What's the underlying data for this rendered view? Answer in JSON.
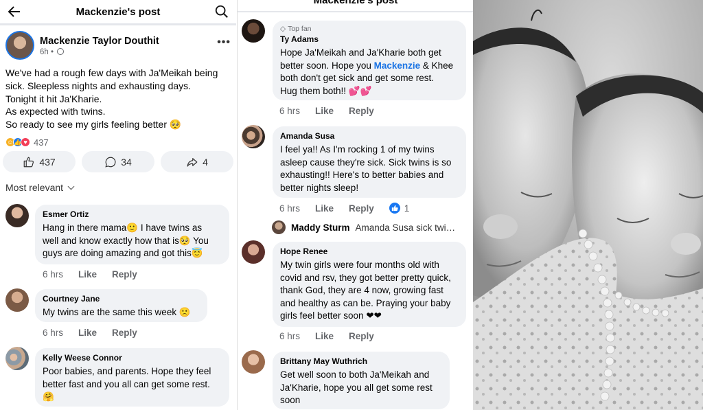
{
  "post": {
    "header_title": "Mackenzie's post",
    "author": "Mackenzie Taylor Douthit",
    "time": "6h",
    "dot": "•",
    "text_lines": [
      "We've had a rough few days with Ja'Meikah being",
      "sick. Sleepless nights and exhausting days.",
      "Tonight it hit Ja'Kharie.",
      "As expected with twins.",
      "So ready to see my girls feeling better 🥺"
    ],
    "reaction_count": "437",
    "like_pill": "437",
    "comment_pill": "34",
    "share_pill": "4",
    "sort_label": "Most relevant"
  },
  "left_comments": [
    {
      "name": "Esmer Ortiz",
      "lines": [
        "Hang in there mama🙂 I have twins as",
        "well and know exactly how that is🥺 You",
        "guys are doing amazing and got this😇"
      ],
      "time": "6 hrs",
      "like": "Like",
      "reply": "Reply"
    },
    {
      "name": "Courtney Jane",
      "lines": [
        "My twins are the same this week 🙁"
      ],
      "time": "6 hrs",
      "like": "Like",
      "reply": "Reply"
    },
    {
      "name": "Kelly Weese Connor",
      "lines": [
        "Poor babies, and parents. Hope they feel",
        "better fast and you all can get some rest.",
        "🤗"
      ]
    }
  ],
  "middle": {
    "header_title": "Mackenzie's post",
    "comments": [
      {
        "badge": "Top fan",
        "name": "Ty Adams",
        "line1": "Hope Ja'Meikah and Ja'Kharie both get",
        "line2_pre": "better soon. Hope you ",
        "line2_mention": "Mackenzie",
        "line2_post": " & Khee",
        "line3": "both don't get sick and get some rest.",
        "line4": "Hug them both!! 💕💕",
        "time": "6 hrs",
        "like": "Like",
        "reply": "Reply"
      },
      {
        "name": "Amanda Susa",
        "lines": [
          "I feel ya!! As I'm rocking 1 of my twins",
          "asleep cause they're sick. Sick twins is so",
          "exhausting!! Here's to better babies and",
          "better nights sleep!"
        ],
        "time": "6 hrs",
        "like": "Like",
        "reply": "Reply",
        "like_count": "1"
      },
      {
        "name": "Hope Renee",
        "lines": [
          "My twin girls were four months old with",
          "covid and rsv, they got better pretty quick,",
          "thank God, they are 4 now, growing fast",
          "and healthy as can be. Praying your baby",
          "girls feel better soon ❤❤"
        ],
        "time": "6 hrs",
        "like": "Like",
        "reply": "Reply"
      },
      {
        "name": "Brittany May Wuthrich",
        "lines": [
          "Get well soon to both Ja'Meikah and",
          "Ja'Kharie, hope you all get some rest",
          "soon"
        ]
      }
    ],
    "reply_preview": {
      "name": "Maddy Sturm",
      "text": "Amanda Susa sick twi…"
    }
  },
  "icons": {
    "back": "back-arrow-icon",
    "search": "search-icon",
    "globe": "globe-icon",
    "like": "thumbs-up-icon",
    "comment": "comment-icon",
    "share": "share-icon"
  },
  "colors": {
    "accent": "#1b74e4",
    "bubble": "#f0f2f5",
    "muted": "#65676b"
  }
}
